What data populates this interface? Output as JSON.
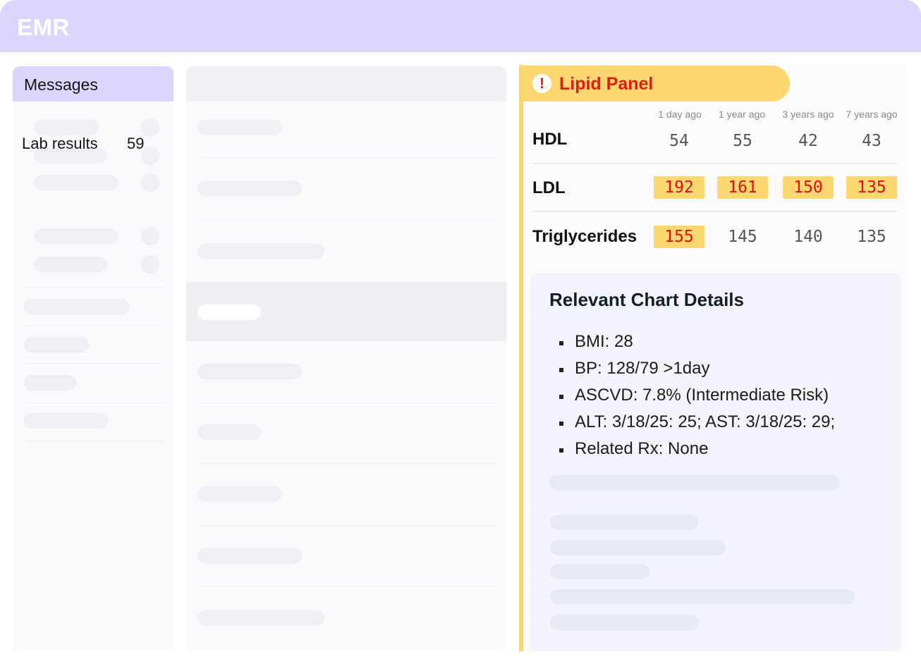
{
  "app": {
    "title": "EMR"
  },
  "sidebar": {
    "title": "Messages",
    "lab_results": {
      "label": "Lab results",
      "count": "59"
    }
  },
  "lipid_panel": {
    "title": "Lipid Panel",
    "alert_glyph": "!",
    "columns": [
      "1 day ago",
      "1 year ago",
      "3 years ago",
      "7 years ago"
    ],
    "rows": [
      {
        "label": "HDL",
        "values": [
          "54",
          "55",
          "42",
          "43"
        ],
        "flagged": [
          false,
          false,
          false,
          false
        ]
      },
      {
        "label": "LDL",
        "values": [
          "192",
          "161",
          "150",
          "135"
        ],
        "flagged": [
          true,
          true,
          true,
          true
        ]
      },
      {
        "label": "Triglycerides",
        "values": [
          "155",
          "145",
          "140",
          "135"
        ],
        "flagged": [
          true,
          false,
          false,
          false
        ]
      }
    ],
    "colors": {
      "flag_bg": "#ffd771",
      "flag_text": "#d71212",
      "accent": "#fdd56f"
    }
  },
  "chart_details": {
    "title": "Relevant Chart Details",
    "items": [
      "BMI: 28",
      "BP: 128/79 >1day",
      "ASCVD: 7.8% (Intermediate Risk)",
      "ALT: 3/18/25: 25; AST: 3/18/25: 29;",
      "Related Rx: None"
    ]
  },
  "theme": {
    "header_bg": "#dcd5fe",
    "skeleton": "#eef0f5"
  }
}
